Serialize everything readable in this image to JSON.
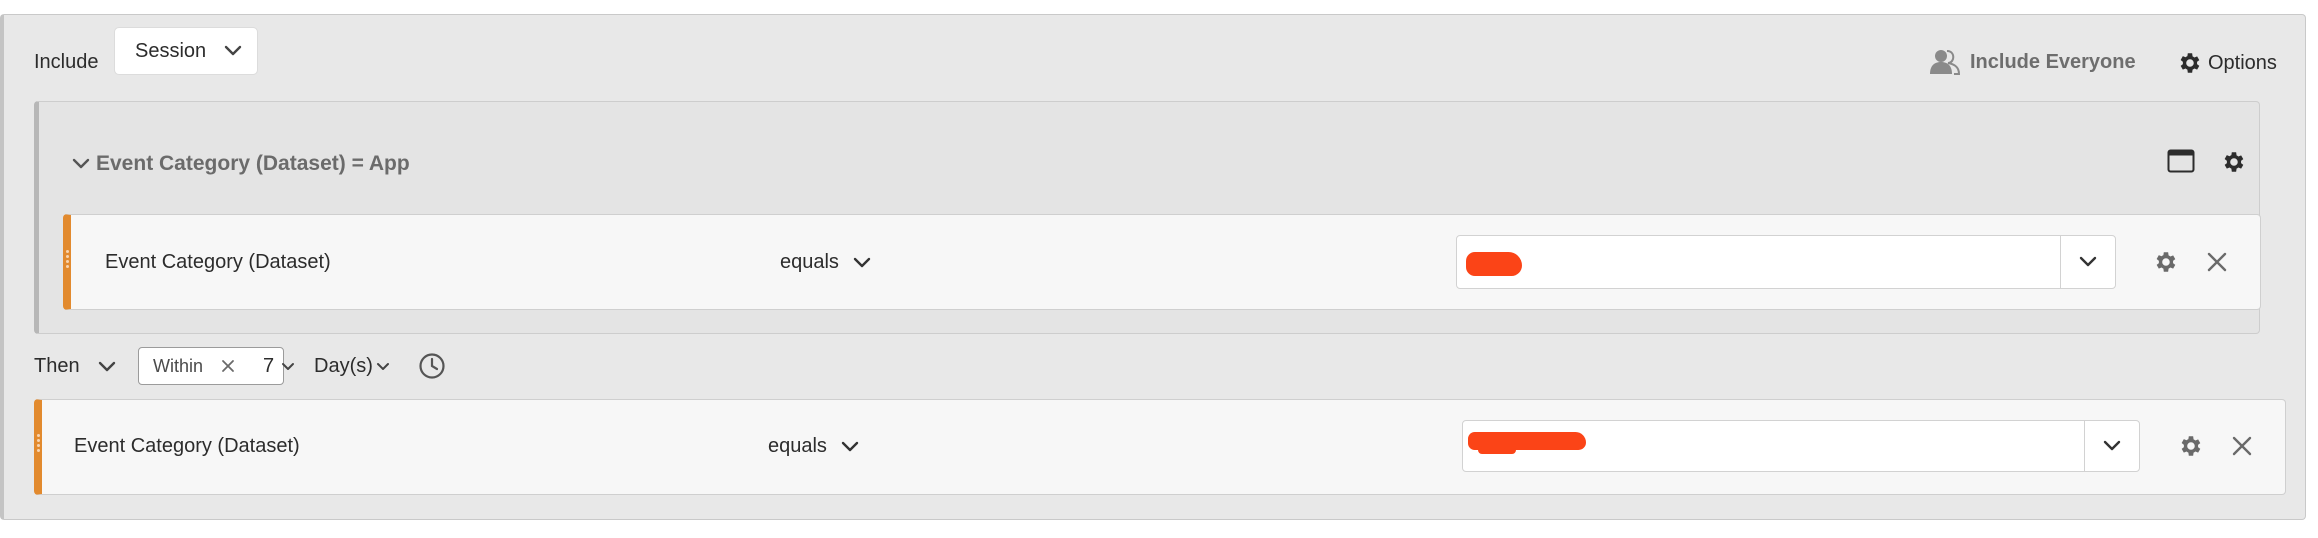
{
  "header": {
    "include_label": "Include",
    "container_select": "Session",
    "include_everyone_label": "Include Everyone",
    "options_label": "Options"
  },
  "container": {
    "title": "Event Category (Dataset) = App",
    "rule": {
      "dimension": "Event Category (Dataset)",
      "operator": "equals",
      "value": ""
    }
  },
  "sequence": {
    "then_label": "Then",
    "within_tag": "Within",
    "count": "7",
    "unit": "Day(s)"
  },
  "rule2": {
    "dimension": "Event Category (Dataset)",
    "operator": "equals",
    "value": ""
  },
  "colors": {
    "accent_orange": "#e28a2e",
    "redaction": "#fb4417",
    "panel_bg": "#e8e8e8"
  },
  "icons": [
    "user-icon",
    "gear-icon",
    "chevron-down-icon",
    "window-icon",
    "close-icon",
    "clock-icon",
    "drag-handle-icon"
  ]
}
